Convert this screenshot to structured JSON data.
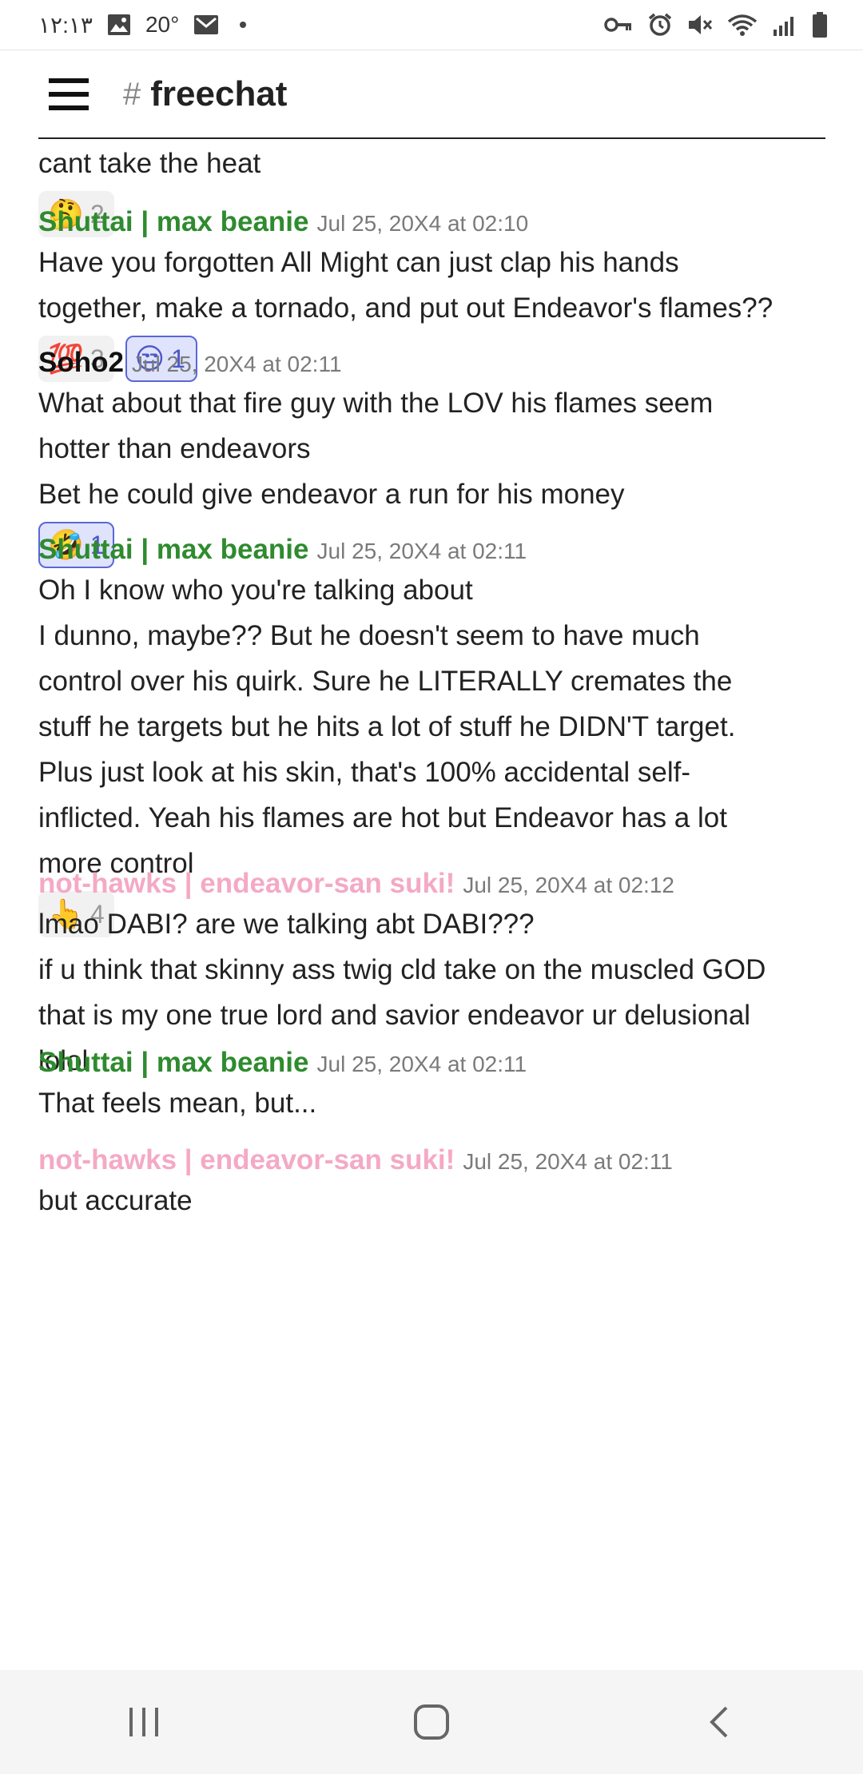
{
  "status_bar": {
    "time": "١٢:١٣",
    "temperature": "20°",
    "left_icons": [
      "image-icon",
      "mail-icon",
      "dot-icon"
    ],
    "right_icons": [
      "key-icon",
      "alarm-icon",
      "mute-icon",
      "wifi-icon",
      "signal-icon",
      "battery-icon"
    ]
  },
  "header": {
    "hash": "#",
    "channel": "freechat",
    "menu_icon": "hamburger-icon"
  },
  "colors": {
    "green_author": "#2e8b2e",
    "pink_author": "#f4a9c4",
    "black_author": "#111111",
    "reaction_selected_border": "#5a67d8"
  },
  "messages": [
    {
      "author": "",
      "timestamp": "",
      "lines": [
        "cant take the heat"
      ],
      "reactions": [
        {
          "emoji": "🤔",
          "count": "2",
          "selected": false
        }
      ]
    },
    {
      "author": "Shuttai | max beanie",
      "timestamp": "Jul 25, 20X4 at 02:10",
      "lines": [
        "Have you forgotten All Might can just clap his hands",
        "together, make a tornado, and put out Endeavor's flames??"
      ],
      "reactions": [
        {
          "emoji": "💯",
          "count": "3",
          "selected": false
        },
        {
          "emoji": "😒",
          "count": "1",
          "selected": true
        }
      ]
    },
    {
      "author": "Soho2",
      "timestamp": "Jul 25, 20X4 at 02:11",
      "lines": [
        "What about that fire guy with the LOV his flames seem",
        "hotter than endeavors",
        "Bet he could give endeavor a run for his money"
      ],
      "reactions": [
        {
          "emoji": "🤣",
          "count": "1",
          "selected": true
        }
      ]
    },
    {
      "author": "Shuttai | max beanie",
      "timestamp": "Jul 25, 20X4 at 02:11",
      "lines": [
        "Oh I know who you're talking about",
        "I dunno, maybe?? But he doesn't seem to have much",
        "control over his quirk. Sure he LITERALLY cremates the",
        "stuff he targets but he hits a lot of stuff he DIDN'T target.",
        "Plus just look at his skin, that's 100% accidental self-",
        "inflicted. Yeah his flames are hot but Endeavor has a lot",
        "more control"
      ],
      "reactions": [
        {
          "emoji": "👆",
          "count": "4",
          "selected": false
        }
      ]
    },
    {
      "author": "not-hawks | endeavor-san suki!",
      "timestamp": "Jul 25, 20X4 at 02:12",
      "lines": [
        "lmao DABI? are we talking abt DABI???",
        "if u think that skinny ass twig cld take on the muscled GOD",
        "that is my one true lord and savior endeavor ur delusional",
        "lolol"
      ],
      "reactions": []
    },
    {
      "author": "Shuttai | max beanie",
      "timestamp": "Jul 25, 20X4 at 02:11",
      "lines": [
        "That feels mean, but..."
      ],
      "reactions": []
    },
    {
      "author": "not-hawks | endeavor-san suki!",
      "timestamp": "Jul 25, 20X4 at 02:11",
      "lines": [
        "but accurate"
      ],
      "reactions": []
    }
  ],
  "nav": {
    "recents": "recents-icon",
    "home": "home-icon",
    "back": "back-icon"
  }
}
